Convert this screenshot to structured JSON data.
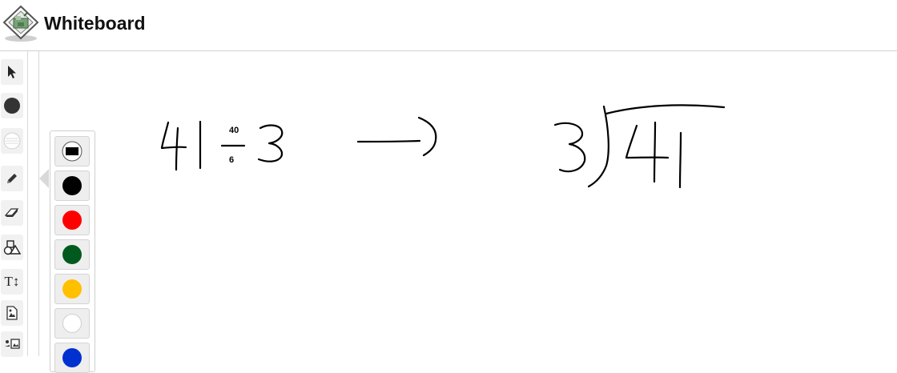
{
  "app": {
    "title": "Whiteboard"
  },
  "toolbar": {
    "tools": [
      {
        "name": "select-tool",
        "icon": "cursor-arrow-icon"
      },
      {
        "name": "color-tool",
        "icon": "filled-circle-icon"
      },
      {
        "name": "background-tool",
        "icon": "lined-circle-icon"
      },
      {
        "name": "pencil-tool",
        "icon": "pencil-icon"
      },
      {
        "name": "eraser-tool",
        "icon": "eraser-icon"
      },
      {
        "name": "shapes-tool",
        "icon": "shapes-icon"
      },
      {
        "name": "text-tool",
        "icon": "text-icon",
        "label": "T↕"
      },
      {
        "name": "image-tool",
        "icon": "image-icon"
      },
      {
        "name": "image-insert-tool",
        "icon": "image-insert-icon"
      }
    ]
  },
  "palette": {
    "colors": [
      "#000000",
      "#ff0000",
      "#005a1e",
      "#ffc000",
      "#ffffff",
      "#0030d0"
    ]
  }
}
